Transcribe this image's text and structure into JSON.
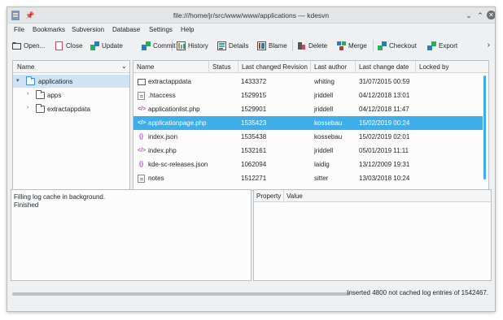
{
  "window": {
    "title": "file:///home/jr/src/www/www/applications — kdesvn",
    "controls": {
      "minimize": "⌄",
      "maximize": "⌃",
      "close": "✕"
    }
  },
  "menubar": [
    "File",
    "Bookmarks",
    "Subversion",
    "Database",
    "Settings",
    "Help"
  ],
  "toolbar": {
    "open": "Open...",
    "close": "Close",
    "update": "Update",
    "commit": "Commit",
    "history": "History",
    "details": "Details",
    "blame": "Blame",
    "delete": "Delete",
    "merge": "Merge",
    "checkout": "Checkout",
    "export": "Export",
    "more": "›"
  },
  "tree": {
    "header": "Name",
    "items": [
      {
        "label": "applications",
        "expanded": true,
        "selected": true
      },
      {
        "label": "apps",
        "expanded": false
      },
      {
        "label": "extractappdata",
        "expanded": false
      }
    ]
  },
  "file_table": {
    "columns": [
      "Name",
      "Status",
      "Last changed Revision",
      "Last author",
      "Last change date",
      "Locked by"
    ],
    "rows": [
      {
        "icon": "folder-icon",
        "name": "extractappdata",
        "status": "",
        "revision": "1433372",
        "author": "whiting",
        "date": "31/07/2015 00:59",
        "locked": ""
      },
      {
        "icon": "text-file-icon",
        "name": ".htaccess",
        "status": "",
        "revision": "1529915",
        "author": "jriddell",
        "date": "04/12/2018 13:01",
        "locked": ""
      },
      {
        "icon": "php-file-icon",
        "name": "applicationlist.php",
        "status": "",
        "revision": "1529901",
        "author": "jriddell",
        "date": "04/12/2018 11:47",
        "locked": ""
      },
      {
        "icon": "php-file-icon",
        "name": "applicationpage.php",
        "status": "",
        "revision": "1535423",
        "author": "kossebau",
        "date": "15/02/2019 00:24",
        "locked": "",
        "selected": true
      },
      {
        "icon": "json-file-icon",
        "name": "index.json",
        "status": "",
        "revision": "1535438",
        "author": "kossebau",
        "date": "15/02/2019 02:01",
        "locked": ""
      },
      {
        "icon": "php-file-icon",
        "name": "index.php",
        "status": "",
        "revision": "1532161",
        "author": "jriddell",
        "date": "05/01/2019 11:11",
        "locked": ""
      },
      {
        "icon": "json-file-icon",
        "name": "kde-sc-releases.json",
        "status": "",
        "revision": "1062094",
        "author": "laidig",
        "date": "13/12/2009 19:31",
        "locked": ""
      },
      {
        "icon": "text-file-icon",
        "name": "notes",
        "status": "",
        "revision": "1512271",
        "author": "sitter",
        "date": "13/03/2018 10:24",
        "locked": ""
      }
    ]
  },
  "log": [
    "Filling log cache in background.",
    "Finished"
  ],
  "properties": {
    "columns": [
      "Property",
      "Value"
    ]
  },
  "statusbar": {
    "text": "Inserted 4800 not cached log entries of 1542467.",
    "progress": 1.0
  },
  "colors": {
    "selection": "#3daee9",
    "tree_selection": "#cfe3f3",
    "window_bg": "#eff0f1"
  }
}
